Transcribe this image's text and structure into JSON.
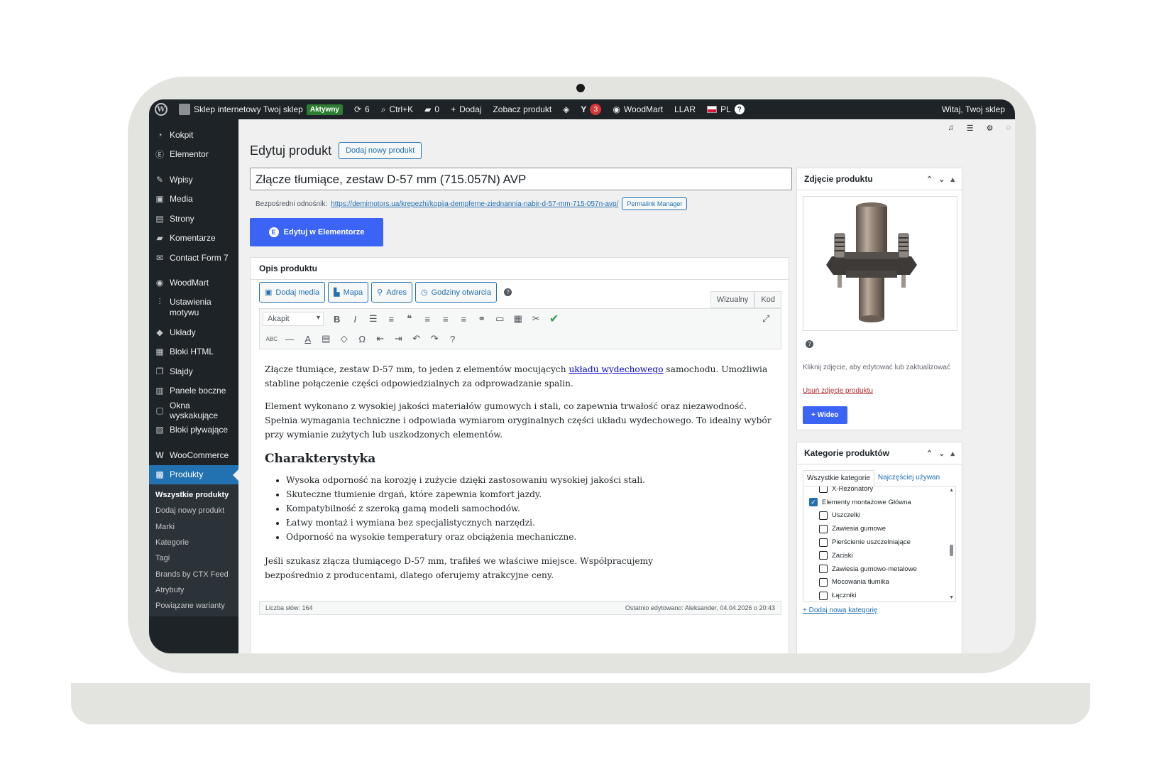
{
  "adminbar": {
    "site_name": "Sklep internetowy Twoj sklep",
    "status_badge": "Aktywny",
    "updates_count": "6",
    "search_shortcut": "Ctrl+K",
    "comments_count": "0",
    "add_label": "Dodaj",
    "view_product": "Zobacz produkt",
    "yoast_count": "3",
    "woodmart": "WoodMart",
    "llar": "LLAR",
    "lang": "PL",
    "greeting": "Witaj, Twoj sklep"
  },
  "sidebar": {
    "items": [
      {
        "label": "Kokpit",
        "icon": "dashboard-icon"
      },
      {
        "label": "Elementor",
        "icon": "elementor-icon"
      },
      {
        "label": "Wpisy",
        "icon": "pin-icon"
      },
      {
        "label": "Media",
        "icon": "media-icon"
      },
      {
        "label": "Strony",
        "icon": "pages-icon"
      },
      {
        "label": "Komentarze",
        "icon": "comments-icon"
      },
      {
        "label": "Contact Form 7",
        "icon": "mail-icon"
      },
      {
        "label": "WoodMart",
        "icon": "woodmart-icon"
      },
      {
        "label": "Ustawienia motywu",
        "icon": "sliders-icon"
      },
      {
        "label": "Układy",
        "icon": "layers-icon"
      },
      {
        "label": "Bloki HTML",
        "icon": "html-block-icon"
      },
      {
        "label": "Slajdy",
        "icon": "slides-icon"
      },
      {
        "label": "Panele boczne",
        "icon": "sidebar-panel-icon"
      },
      {
        "label": "Okna wyskakujące",
        "icon": "popup-icon"
      },
      {
        "label": "Bloki pływające",
        "icon": "floating-block-icon"
      },
      {
        "label": "WooCommerce",
        "icon": "woocommerce-icon"
      },
      {
        "label": "Produkty",
        "icon": "products-icon"
      }
    ],
    "submenu": [
      "Wszystkie produkty",
      "Dodaj nowy produkt",
      "Marki",
      "Kategorie",
      "Tagi",
      "Brands by CTX Feed",
      "Atrybuty",
      "Powiązane warianty"
    ]
  },
  "main": {
    "page_title": "Edytuj produkt",
    "add_new_button": "Dodaj nowy produkt",
    "product_title": "Złącze tłumiące, zestaw D-57 mm (715.057N) AVP",
    "permalink_label": "Bezpośredni odnośnik:",
    "permalink_url": "https://demimotors.ua/krepezhi/kopija-dempferne-ziednannia-nabir-d-57-mm-715-057n-avp/",
    "permalink_manager": "Permalink Manager",
    "elementor_button": "Edytuj w Elementorze"
  },
  "editor": {
    "box_title": "Opis produktu",
    "media_buttons": [
      "Dodaj media",
      "Mapa",
      "Adres",
      "Godziny otwarcia"
    ],
    "mode_visual": "Wizualny",
    "mode_code": "Kod",
    "format_select": "Akapit",
    "p1_before": "Złącze tłumiące, zestaw D-57 mm, to jeden z elementów mocujących ",
    "p1_link": "układu wydechowego",
    "p1_after": " samochodu. Umożliwia stabline połączenie części odpowiedzialnych za odprowadzanie spalin.",
    "p2": "Element wykonano z wysokiej jakości materiałów gumowych i stali, co zapewnia trwałość oraz niezawodność. Spełnia wymagania techniczne i odpowiada wymiarom oryginalnych części układu wydechowego. To idealny wybór przy wymianie zużytych lub uszkodzonych elementów.",
    "heading": "Charakterystyka",
    "bullets": [
      "Wysoka odporność na korozję i zużycie dzięki zastosowaniu wysokiej jakości stali.",
      "Skuteczne tłumienie drgań, które zapewnia komfort jazdy.",
      "Kompatybilność z szeroką gamą modeli samochodów.",
      "Łatwy montaż i wymiana bez specjalistycznych narzędzi.",
      "Odporność na wysokie temperatury oraz obciążenia mechaniczne."
    ],
    "p3": "Jeśli szukasz złącza tłumiącego D-57 mm, trafiłeś we właściwe miejsce. Współpracujemy bezpośrednio z producentami, dlatego oferujemy atrakcyjne ceny.",
    "word_count": "Liczba słów: 164",
    "last_edited": "Ostatnio edytowano: Aleksander, 04.04.2026 o 20:43"
  },
  "image_panel": {
    "title": "Zdjęcie produktu",
    "hint": "Kliknij zdjęcie, aby edytować lub zaktualizować",
    "remove": "Usuń zdjęcie produktu",
    "video_button": "+ Wideo"
  },
  "category_panel": {
    "title": "Kategorie produktów",
    "tab_all": "Wszystkie kategorie",
    "tab_popular": "Najczęściej używan",
    "categories": [
      {
        "label": "X-Rezonatory",
        "checked": false,
        "indent": 1
      },
      {
        "label": "Elementy montażowe Główna",
        "checked": true,
        "indent": 0
      },
      {
        "label": "Uszczelki",
        "checked": false,
        "indent": 1
      },
      {
        "label": "Zawiesia gumowe",
        "checked": false,
        "indent": 1
      },
      {
        "label": "Pierścienie uszczelniające",
        "checked": false,
        "indent": 1
      },
      {
        "label": "Zaciski",
        "checked": false,
        "indent": 1
      },
      {
        "label": "Zawiesia gumowo-metalowe",
        "checked": false,
        "indent": 1
      },
      {
        "label": "Mocowania tłumika",
        "checked": false,
        "indent": 1
      },
      {
        "label": "Łączniki",
        "checked": false,
        "indent": 1
      }
    ],
    "add_category": "+ Dodaj nową kategorię"
  }
}
